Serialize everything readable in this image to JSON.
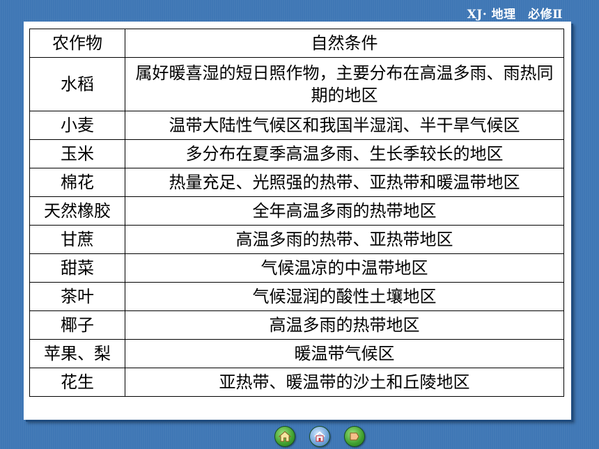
{
  "header": {
    "title": "XJ· 地理　必修Ⅱ"
  },
  "table": {
    "headers": {
      "crop": "农作物",
      "condition": "自然条件"
    },
    "rows": [
      {
        "crop": "水稻",
        "condition": "属好暖喜湿的短日照作物，主要分布在高温多雨、雨热同期的地区"
      },
      {
        "crop": "小麦",
        "condition": "温带大陆性气候区和我国半湿润、半干旱气候区"
      },
      {
        "crop": "玉米",
        "condition": "多分布在夏季高温多雨、生长季较长的地区"
      },
      {
        "crop": "棉花",
        "condition": "热量充足、光照强的热带、亚热带和暖温带地区"
      },
      {
        "crop": "天然橡胶",
        "condition": "全年高温多雨的热带地区"
      },
      {
        "crop": "甘蔗",
        "condition": "高温多雨的热带、亚热带地区"
      },
      {
        "crop": "甜菜",
        "condition": "气候温凉的中温带地区"
      },
      {
        "crop": "茶叶",
        "condition": "气候湿润的酸性土壤地区"
      },
      {
        "crop": "椰子",
        "condition": "高温多雨的热带地区"
      },
      {
        "crop": "苹果、梨",
        "condition": "暖温带气候区"
      },
      {
        "crop": "花生",
        "condition": "亚热带、暖温带的沙土和丘陵地区"
      }
    ]
  },
  "nav": {
    "buttons": [
      {
        "icon": "home-icon",
        "color": "#3f9f2f"
      },
      {
        "icon": "return-icon",
        "color": "#6da2d8"
      },
      {
        "icon": "next-icon",
        "color": "#3f9f2f"
      }
    ]
  },
  "colors": {
    "background": "#3f77b5",
    "panel": "#ffffff",
    "header_text": "#ffffff"
  }
}
